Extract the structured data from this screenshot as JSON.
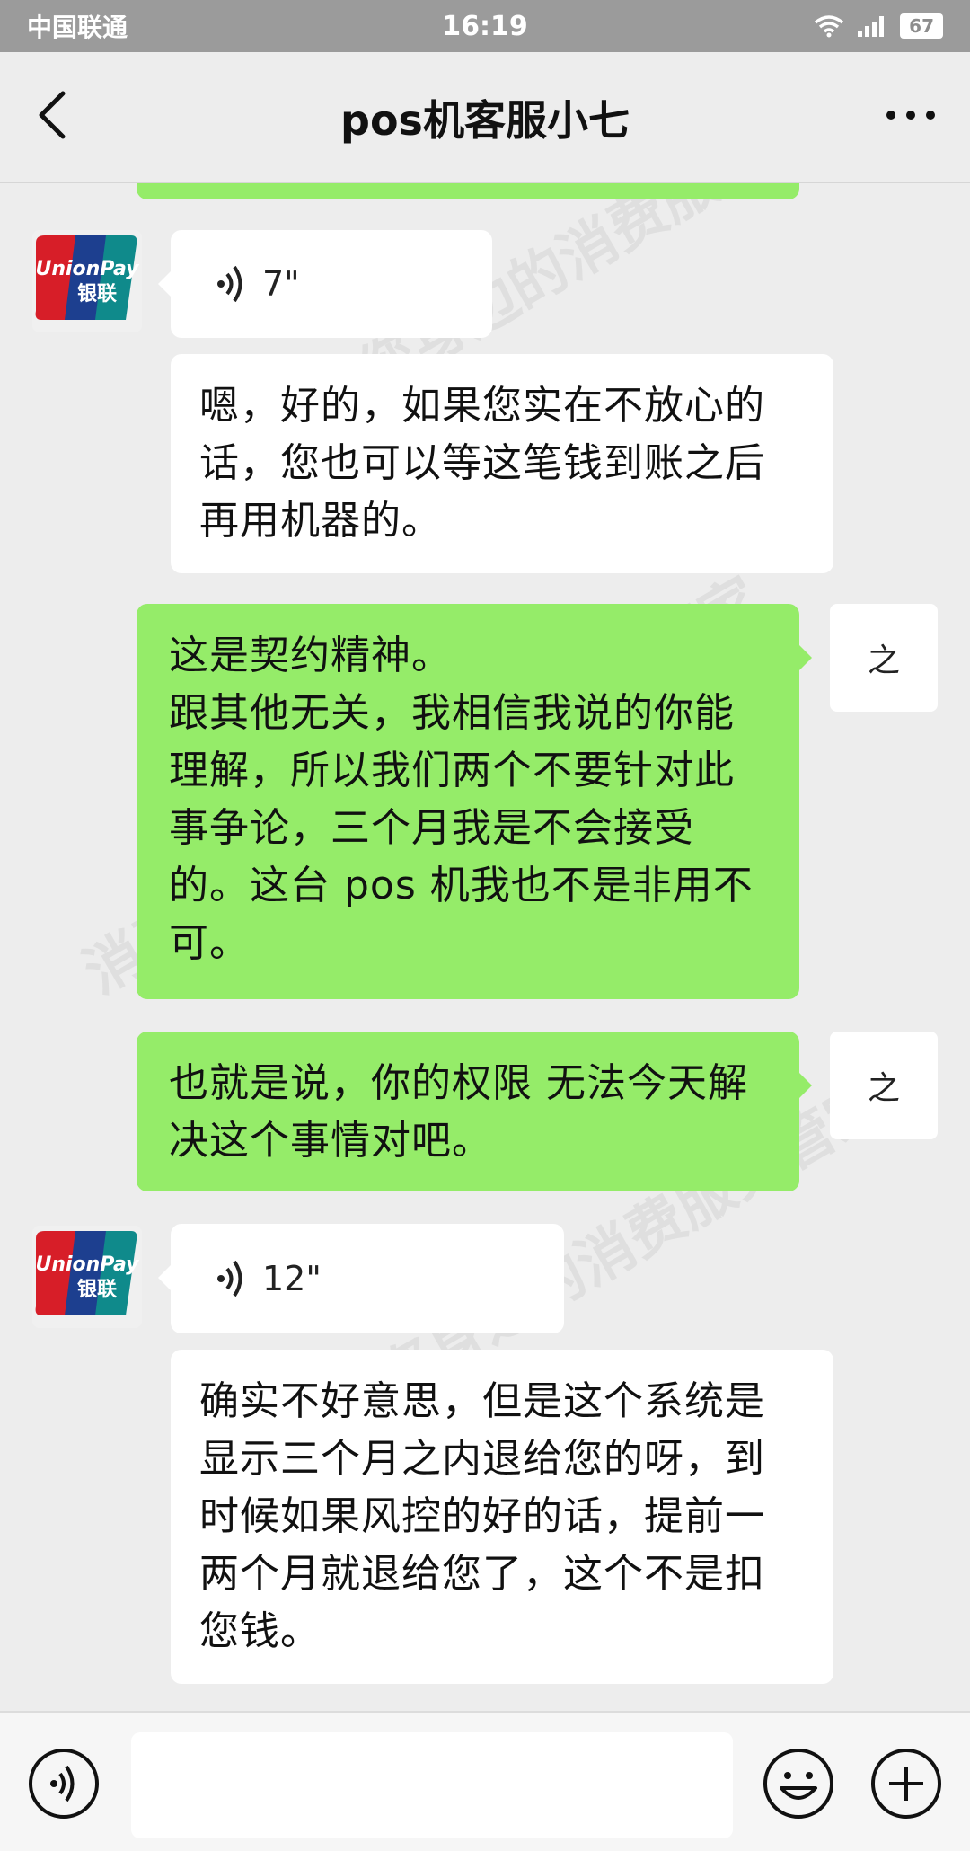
{
  "status": {
    "carrier": "中国联通",
    "time": "16:19",
    "battery": "67"
  },
  "nav": {
    "title": "pos机客服小七"
  },
  "messages": {
    "voice1_duration": "7\"",
    "m1": "嗯，好的，如果您实在不放心的话，您也可以等这笔钱到账之后再用机器的。",
    "m2": "这是契约精神。\n跟其他无关，我相信我说的你能理解，所以我们两个不要针对此事争论，三个月我是不会接受的。这台 pos 机我也不是非用不可。",
    "m3": "也就是说，你的权限 无法今天解决这个事情对吧。",
    "voice2_duration": "12\"",
    "m4": "确实不好意思，但是这个系统是显示三个月之内退给您的呀，到时候如果风控的好的话，提前一两个月就退给您了，这个不是扣您钱。",
    "me_avatar_text": "之"
  },
  "avatar": {
    "unionpay_en": "UnionPay",
    "unionpay_cn": "银联"
  },
  "watermark": "消费保 您身边的消费服务管家",
  "colors": {
    "incoming": "#ffffff",
    "outgoing": "#95ec69",
    "background": "#ededed"
  }
}
